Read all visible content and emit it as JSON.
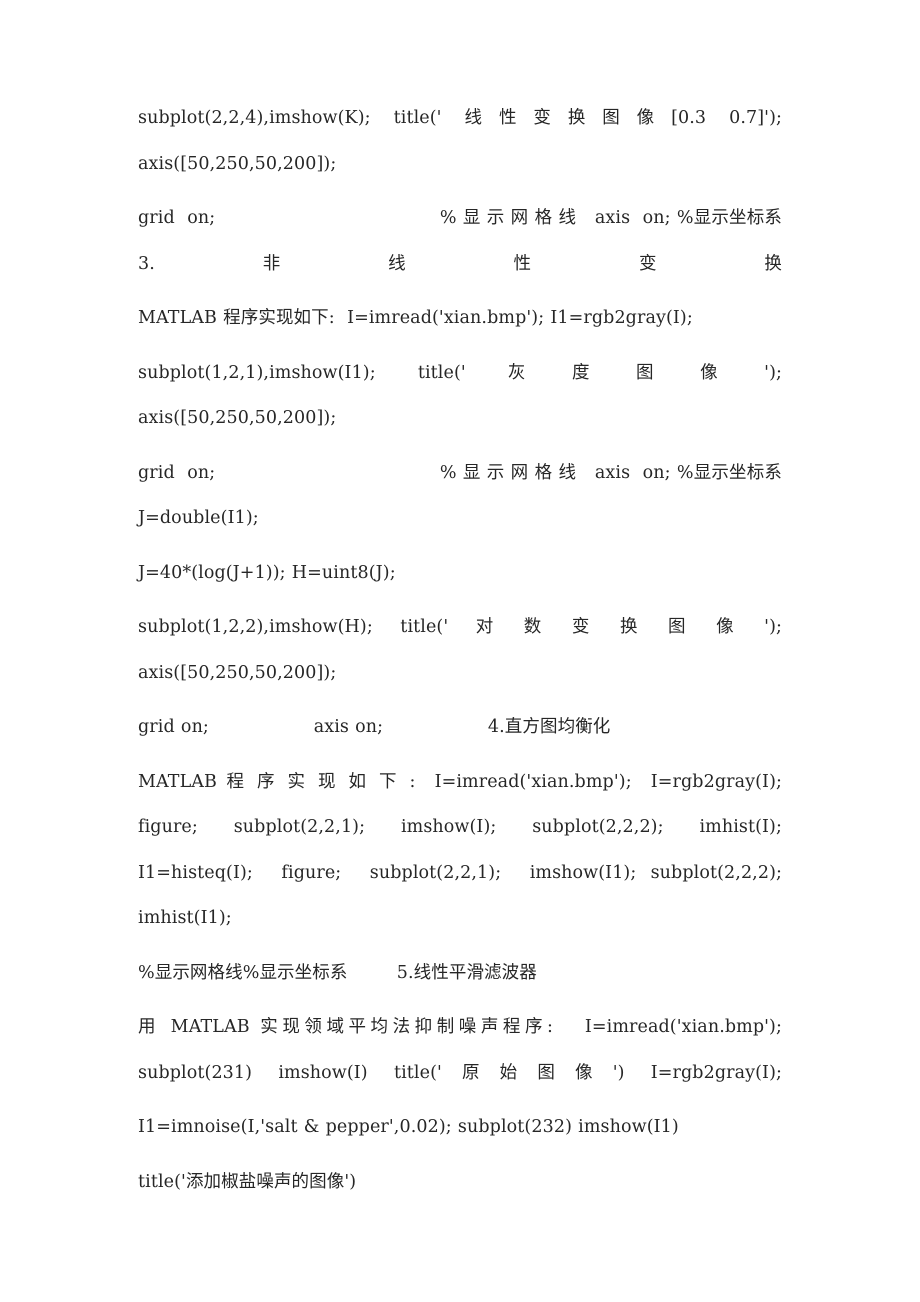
{
  "document": {
    "background_color": "#ffffff",
    "text_color": "#262626",
    "paragraphs": [
      {
        "id": "p1",
        "lines": [
          "subplot(2,2,4),imshow(K);  title('  线 性 变 换 图 像 [0.3  0.7]');",
          "axis([50,250,50,200]);"
        ],
        "text": "subplot(2,2,4),imshow(K);  title('  线 性 变 换 图 像 [0.3  0.7]');  axis([50,250,50,200]);"
      },
      {
        "id": "p2",
        "lines": [
          "grid  on;                                    % 显 示 网 格 线   axis  on;",
          "%显示坐标系 3.非线性变换"
        ],
        "text": "grid  on;                                    % 显 示 网 格 线   axis  on; %显示坐标系 3.非线性变换"
      },
      {
        "id": "p3",
        "lines": [
          "MATLAB 程序实现如下:  I=imread('xian.bmp'); I1=rgb2gray(I);"
        ],
        "text": "MATLAB 程序实现如下:  I=imread('xian.bmp'); I1=rgb2gray(I);"
      },
      {
        "id": "p4",
        "lines": [
          "subplot(1,2,1),imshow(I1);    title('    灰    度    图    像    ');",
          "axis([50,250,50,200]);"
        ],
        "text": "subplot(1,2,1),imshow(I1);    title('    灰    度    图    像    ');  axis([50,250,50,200]);"
      },
      {
        "id": "p5",
        "lines": [
          "grid  on;                                    % 显 示 网 格 线   axis  on;",
          "%显示坐标系 J=double(I1);"
        ],
        "text": "grid  on;                                    % 显 示 网 格 线   axis  on; %显示坐标系 J=double(I1);"
      },
      {
        "id": "p6",
        "lines": [
          "J=40*(log(J+1)); H=uint8(J);"
        ],
        "text": "J=40*(log(J+1)); H=uint8(J);"
      },
      {
        "id": "p7",
        "lines": [
          "subplot(1,2,2),imshow(H);   title('   对   数   变   换   图   像   ');",
          "axis([50,250,50,200]);"
        ],
        "text": "subplot(1,2,2),imshow(H);   title('   对   数   变   换   图   像   ');  axis([50,250,50,200]);"
      },
      {
        "id": "p8",
        "lines": [
          "grid on;                 axis on;                 4.直方图均衡化"
        ],
        "text": "grid on;                 axis on;                 4.直方图均衡化"
      },
      {
        "id": "p9",
        "lines": [
          "MATLAB 程 序 实 现 如 下 :  I=imread('xian.bmp');  I=rgb2gray(I);",
          "figure;  subplot(2,2,1);  imshow(I);  subplot(2,2,2);  imhist(I);",
          "I1=histeq(I);         figure;         subplot(2,2,1);         imshow(I1);",
          "subplot(2,2,2); imhist(I1);"
        ],
        "text": "MATLAB 程 序 实 现 如 下 :  I=imread('xian.bmp');  I=rgb2gray(I); figure;  subplot(2,2,1);  imshow(I);  subplot(2,2,2);  imhist(I); I1=histeq(I);  figure;  subplot(2,2,1);  imshow(I1); subplot(2,2,2); imhist(I1);"
      },
      {
        "id": "p10",
        "lines": [
          "%显示网格线%显示坐标系        5.线性平滑滤波器"
        ],
        "text": "%显示网格线%显示坐标系        5.线性平滑滤波器"
      },
      {
        "id": "p11",
        "lines": [
          "用 MATLAB 实现领域平均法抑制噪声程序:   I=imread('xian.bmp');",
          "subplot(231) imshow(I) title('原始图像') I=rgb2gray(I);"
        ],
        "text": "用 MATLAB 实现领域平均法抑制噪声程序:   I=imread('xian.bmp'); subplot(231) imshow(I) title('原始图像') I=rgb2gray(I);"
      },
      {
        "id": "p12",
        "lines": [
          "I1=imnoise(I,'salt & pepper',0.02); subplot(232) imshow(I1)"
        ],
        "text": "I1=imnoise(I,'salt & pepper',0.02); subplot(232) imshow(I1)"
      },
      {
        "id": "p13",
        "lines": [
          "title('添加椒盐噪声的图像')"
        ],
        "text": "title('添加椒盐噪声的图像')"
      }
    ]
  }
}
